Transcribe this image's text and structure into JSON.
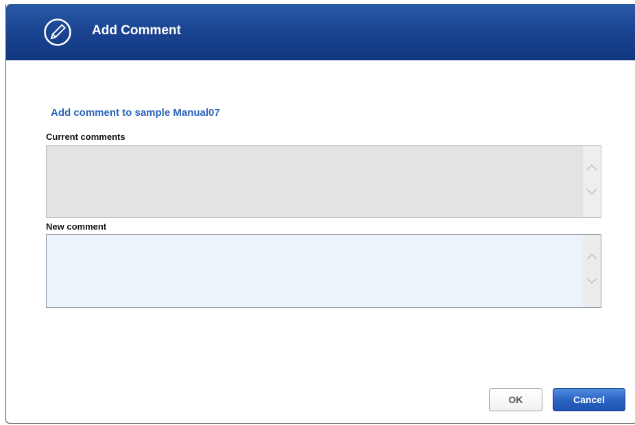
{
  "dialog": {
    "title": "Add Comment",
    "title_icon": "pencil-circle-icon",
    "subtitle": "Add comment to sample Manual07"
  },
  "current_comments": {
    "label": "Current comments",
    "value": ""
  },
  "new_comment": {
    "label": "New comment",
    "value": ""
  },
  "buttons": {
    "ok": "OK",
    "cancel": "Cancel"
  },
  "colors": {
    "header": "#1b4592",
    "subtitle": "#2a64b8",
    "current_bg": "#e3e3e3",
    "new_bg": "#ecf3fb",
    "cancel_bg": "#2a62c2"
  }
}
